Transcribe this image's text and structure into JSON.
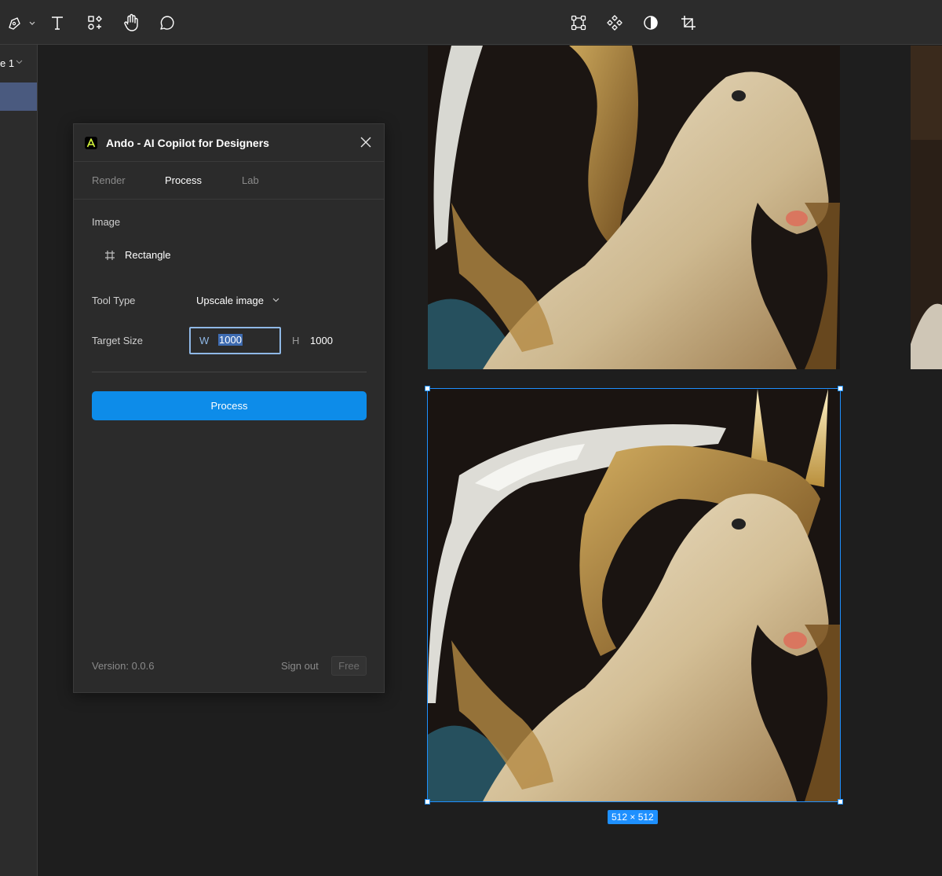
{
  "toolbar": {
    "left_tools": [
      {
        "icon": "pen-icon"
      },
      {
        "icon": "text-icon"
      },
      {
        "icon": "resources-icon"
      },
      {
        "icon": "hand-icon"
      },
      {
        "icon": "comment-icon"
      }
    ],
    "center_tools": [
      {
        "icon": "transform-icon"
      },
      {
        "icon": "component-icon"
      },
      {
        "icon": "contrast-icon"
      },
      {
        "icon": "crop-icon"
      }
    ]
  },
  "sidebar": {
    "page_label": "e 1"
  },
  "canvas": {
    "selection_size": "512 × 512",
    "selection_color": "#1e90ff"
  },
  "plugin": {
    "title": "Ando - AI Copilot for Designers",
    "logo_color": "#d4f53c",
    "tabs": [
      {
        "label": "Render",
        "active": false
      },
      {
        "label": "Process",
        "active": true
      },
      {
        "label": "Lab",
        "active": false
      }
    ],
    "image_label": "Image",
    "image_layer": "Rectangle",
    "tool_type_label": "Tool Type",
    "tool_type_value": "Upscale image",
    "target_size_label": "Target Size",
    "width_prefix": "W",
    "width_value": "1000",
    "height_prefix": "H",
    "height_value": "1000",
    "process_button": "Process",
    "accent_color": "#0d8ce9",
    "version": "Version: 0.0.6",
    "sign_out": "Sign out",
    "plan_badge": "Free"
  }
}
